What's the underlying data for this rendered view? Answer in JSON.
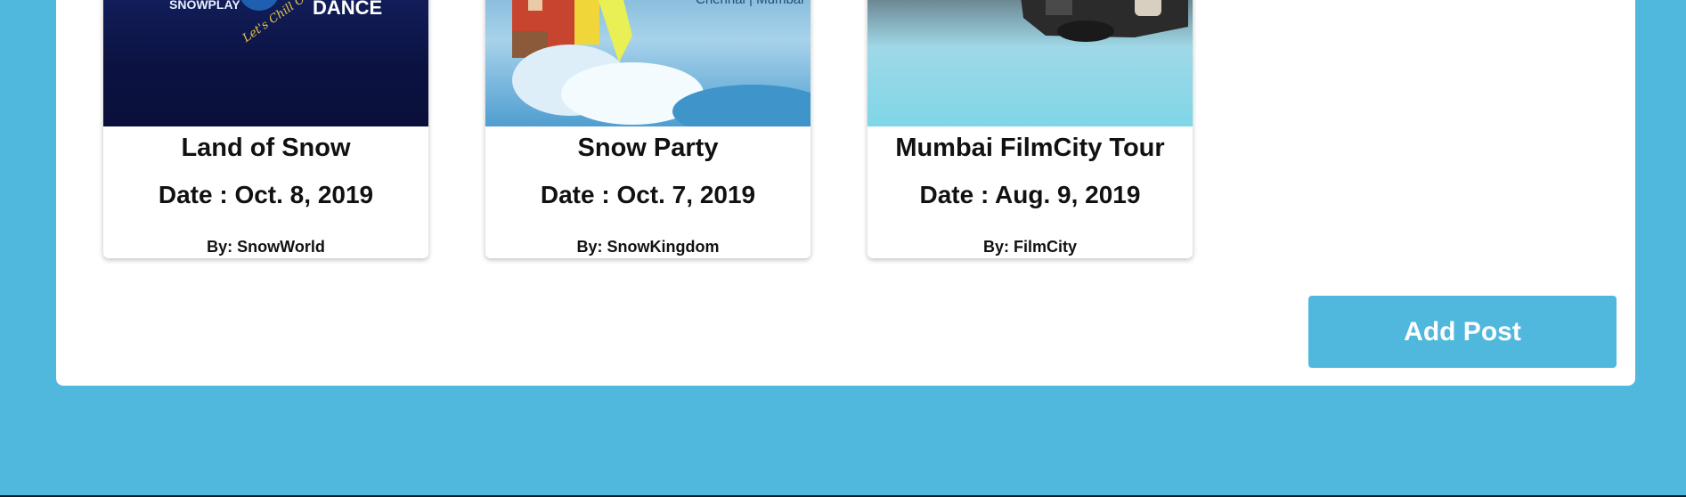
{
  "posts": [
    {
      "title": "Land of Snow",
      "date": "Date : Oct. 8, 2019",
      "by": "By: SnowWorld",
      "image_text": [
        "SNOWPLAY",
        "DANCE",
        "Let's Chill Out"
      ]
    },
    {
      "title": "Snow Party",
      "date": "Date : Oct. 7, 2019",
      "by": "By: SnowKingdom",
      "image_text": [
        "Chennai | Mumbai"
      ]
    },
    {
      "title": "Mumbai FilmCity Tour",
      "date": "Date : Aug. 9, 2019",
      "by": "By: FilmCity",
      "image_text": []
    }
  ],
  "actions": {
    "add_post_label": "Add Post"
  },
  "colors": {
    "page_background": "#50b8dd",
    "panel_background": "#ffffff",
    "button_background": "#50b8dd",
    "button_text": "#ffffff",
    "text": "#111111"
  }
}
